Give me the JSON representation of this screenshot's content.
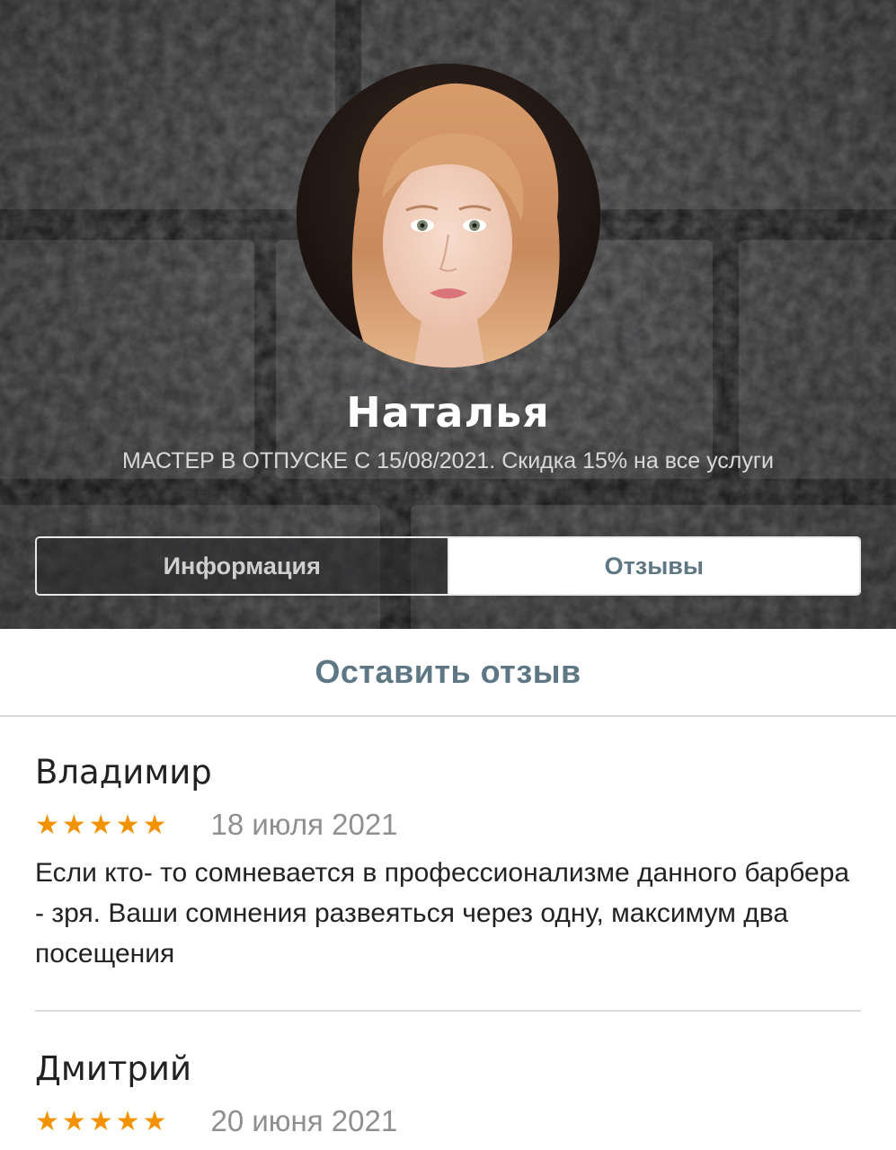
{
  "master": {
    "name": "Наталья",
    "status": "МАСТЕР В ОТПУСКЕ С 15/08/2021. Скидка 15% на все услуги"
  },
  "tabs": [
    {
      "label": "Информация",
      "active": false
    },
    {
      "label": "Отзывы",
      "active": true
    }
  ],
  "leave_review_label": "Оставить отзыв",
  "reviews": [
    {
      "author": "Владимир",
      "stars": "★★★★★",
      "rating": 5,
      "date": "18 июля 2021",
      "text": "Если кто- то сомневается в профессионализме данного барбера - зря. Ваши сомнения развеяться через одну, максимум два посещения"
    },
    {
      "author": "Дмитрий",
      "stars": "★★★★★",
      "rating": 5,
      "date": "20 июня 2021",
      "text": ""
    }
  ],
  "colors": {
    "accent": "#5e7785",
    "star": "#f39200",
    "header_bg": "#2c2c2e"
  }
}
